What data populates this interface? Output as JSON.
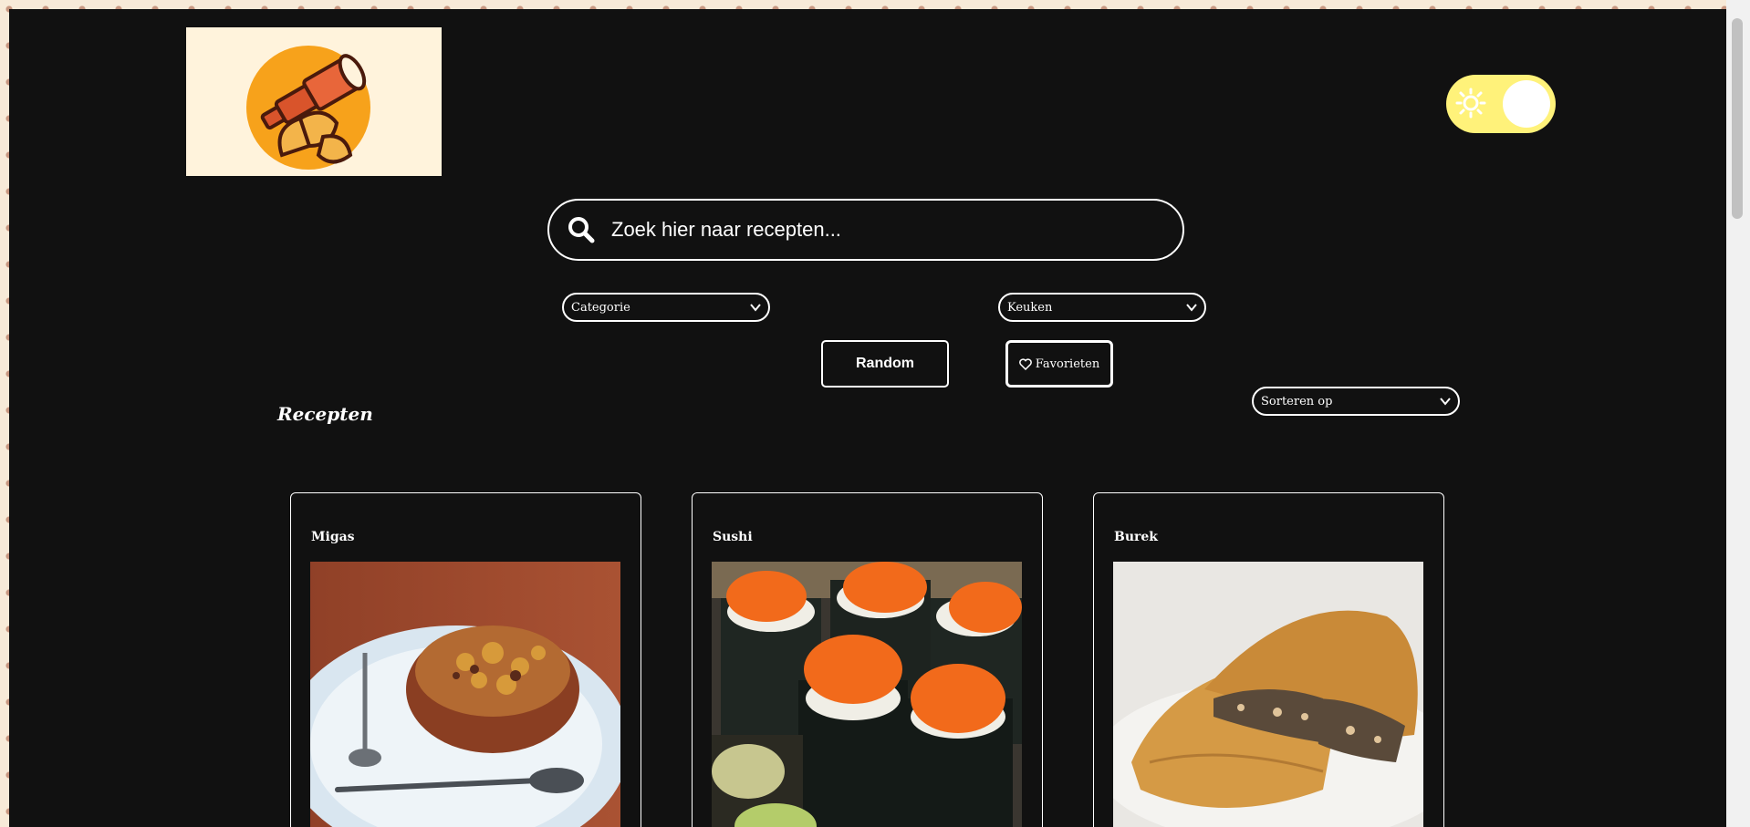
{
  "search": {
    "placeholder": "Zoek hier naar recepten..."
  },
  "filters": {
    "category_label": "Categorie",
    "cuisine_label": "Keuken",
    "sort_label": "Sorteren op"
  },
  "buttons": {
    "random_label": "Random",
    "favorites_label": "Favorieten"
  },
  "section": {
    "title": "Recepten"
  },
  "recipes": [
    {
      "title": "Migas"
    },
    {
      "title": "Sushi"
    },
    {
      "title": "Burek"
    }
  ],
  "colors": {
    "app_background": "#111111",
    "page_background": "#f7ead8",
    "toggle_track": "#fff27a",
    "logo_background": "#fff3dc",
    "logo_accent": "#f7a21b"
  },
  "icons": [
    "telescope-croissant-logo",
    "sun-icon",
    "search-icon",
    "chevron-down-icon",
    "heart-icon"
  ]
}
